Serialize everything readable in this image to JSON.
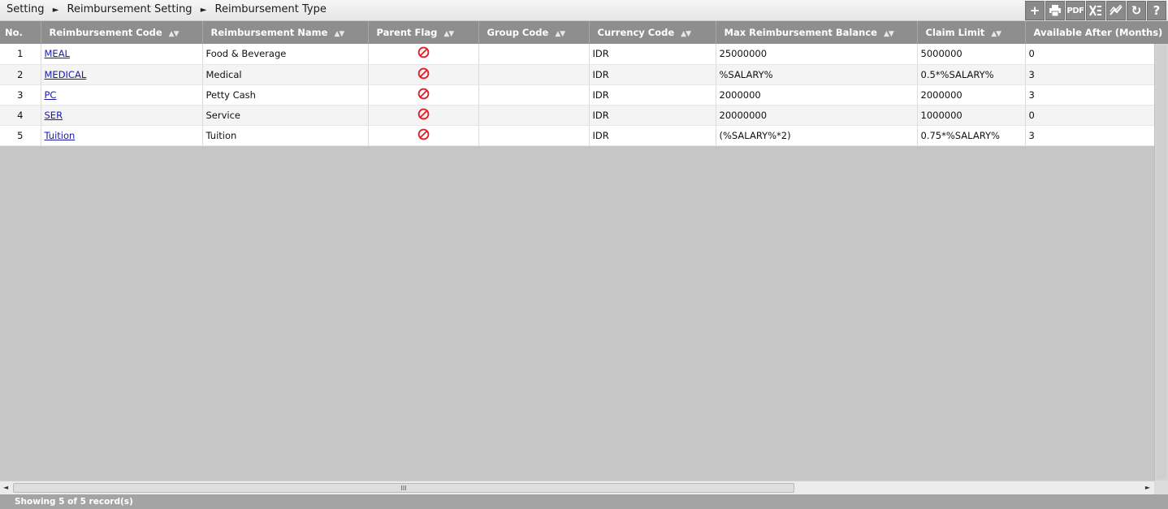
{
  "breadcrumb": {
    "items": [
      "Setting",
      "Reimbursement Setting",
      "Reimbursement Type"
    ],
    "separator": "►"
  },
  "toolbar": {
    "add": "+",
    "print": "🖶",
    "pdf": "PDF",
    "excel": "X",
    "chart": "≈",
    "refresh": "↻",
    "help": "?"
  },
  "table": {
    "columns": [
      "No.",
      "Reimbursement Code",
      "Reimbursement Name",
      "Parent Flag",
      "Group Code",
      "Currency Code",
      "Max Reimbursement Balance",
      "Claim Limit",
      "Available After (Months)"
    ],
    "sort_glyph": "▲▼",
    "rows": [
      {
        "no": "1",
        "code": "MEAL",
        "name": "Food & Beverage",
        "parent_flag": "no",
        "group": "",
        "currency": "IDR",
        "max_balance": "25000000",
        "claim_limit": "5000000",
        "available_after": "0"
      },
      {
        "no": "2",
        "code": "MEDICAL",
        "name": "Medical",
        "parent_flag": "no",
        "group": "",
        "currency": "IDR",
        "max_balance": "%SALARY%",
        "claim_limit": "0.5*%SALARY%",
        "available_after": "3"
      },
      {
        "no": "3",
        "code": "PC",
        "name": "Petty Cash",
        "parent_flag": "no",
        "group": "",
        "currency": "IDR",
        "max_balance": "2000000",
        "claim_limit": "2000000",
        "available_after": "3"
      },
      {
        "no": "4",
        "code": "SER",
        "name": "Service",
        "parent_flag": "no",
        "group": "",
        "currency": "IDR",
        "max_balance": "20000000",
        "claim_limit": "1000000",
        "available_after": "0"
      },
      {
        "no": "5",
        "code": "Tuition",
        "name": "Tuition",
        "parent_flag": "no",
        "group": "",
        "currency": "IDR",
        "max_balance": "(%SALARY%*2)",
        "claim_limit": "0.75*%SALARY%",
        "available_after": "3"
      }
    ]
  },
  "scrollbar": {
    "thumb_grip": "III"
  },
  "footer": {
    "status": "Showing 5 of 5 record(s)"
  },
  "colors": {
    "header_bg": "#8e8e8e",
    "link": "#1a1aa6",
    "no_icon": "#e0202a",
    "canvas": "#c6c6c6",
    "footer_bg": "#a4a4a4"
  }
}
